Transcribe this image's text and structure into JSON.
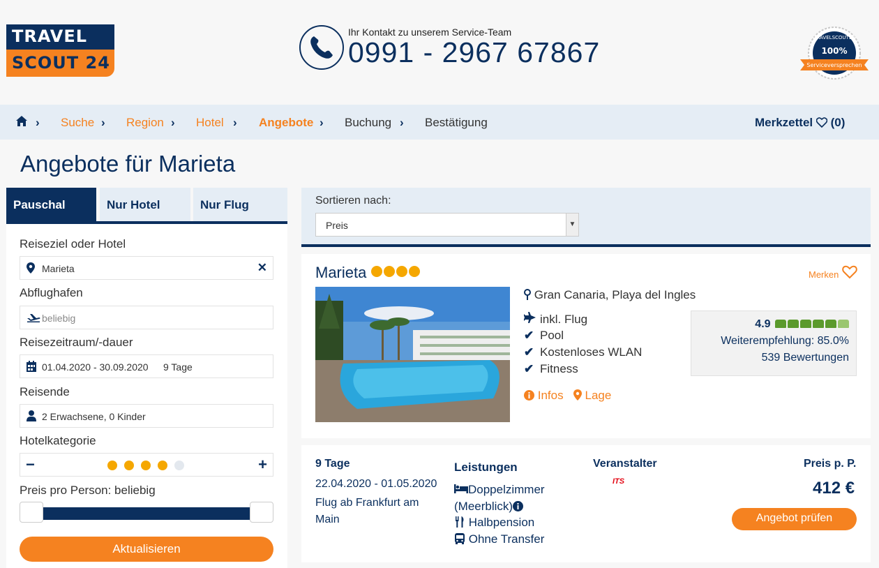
{
  "header": {
    "logo": {
      "line1": "TRAVEL",
      "line2": "SCOUT 24"
    },
    "contact_label": "Ihr Kontakt zu unserem Service-Team",
    "phone": "0991 - 2967 67867",
    "badge": {
      "top": "TRAVELSCOUT24",
      "percent": "100%",
      "ribbon": "Serviceversprechen"
    }
  },
  "breadcrumb": {
    "items": [
      {
        "label": "Suche"
      },
      {
        "label": "Region"
      },
      {
        "label": "Hotel"
      },
      {
        "label": "Angebote"
      },
      {
        "label": "Buchung"
      },
      {
        "label": "Bestätigung"
      }
    ],
    "merkzettel": "Merkzettel",
    "merkzettel_count": "(0)"
  },
  "page_title": "Angebote für Marieta",
  "search": {
    "tabs": [
      {
        "label": "Pauschal"
      },
      {
        "label": "Nur Hotel"
      },
      {
        "label": "Nur Flug"
      }
    ],
    "destination_label": "Reiseziel oder Hotel",
    "destination_value": "Marieta",
    "airport_label": "Abflughafen",
    "airport_placeholder": "beliebig",
    "period_label": "Reisezeitraum/-dauer",
    "period_value": "01.04.2020 - 30.09.2020",
    "duration_value": "9 Tage",
    "travellers_label": "Reisende",
    "travellers_value": "2 Erwachsene, 0 Kinder",
    "category_label": "Hotelkategorie",
    "category_stars": 4,
    "category_max": 5,
    "price_label": "Preis pro Person: beliebig",
    "update_button": "Aktualisieren"
  },
  "sort": {
    "label": "Sortieren nach:",
    "selected": "Preis"
  },
  "hotel": {
    "name": "Marieta",
    "stars": 4,
    "save_label": "Merken",
    "location": "Gran Canaria, Playa del Ingles",
    "features": [
      {
        "icon": "plane-icon",
        "label": "inkl. Flug"
      },
      {
        "icon": "check-icon",
        "label": "Pool"
      },
      {
        "icon": "check-icon",
        "label": "Kostenloses WLAN"
      },
      {
        "icon": "check-icon",
        "label": "Fitness"
      }
    ],
    "info_link": "Infos",
    "location_link": "Lage",
    "rating": {
      "score": "4.9",
      "recommendation": "Weiterempfehlung: 85.0%",
      "reviews": "539 Bewertungen"
    }
  },
  "offer": {
    "days": "9 Tage",
    "dates": "22.04.2020 - 01.05.2020",
    "flight": "Flug ab Frankfurt am Main",
    "services_title": "Leistungen",
    "services": [
      {
        "icon": "bed-icon",
        "label": "Doppelzimmer (Meerblick)"
      },
      {
        "icon": "cutlery-icon",
        "label": "Halbpension"
      },
      {
        "icon": "bus-icon",
        "label": "Ohne Transfer"
      }
    ],
    "operator_title": "Veranstalter",
    "operator_logo": "ITS",
    "price_label": "Preis p. P.",
    "price": "412 €",
    "button": "Angebot prüfen"
  },
  "colors": {
    "navy": "#0b2f5e",
    "orange": "#f58220",
    "light_blue": "#e5edf5",
    "star_yellow": "#f5a700",
    "thumb_green": "#5b9a2c"
  }
}
